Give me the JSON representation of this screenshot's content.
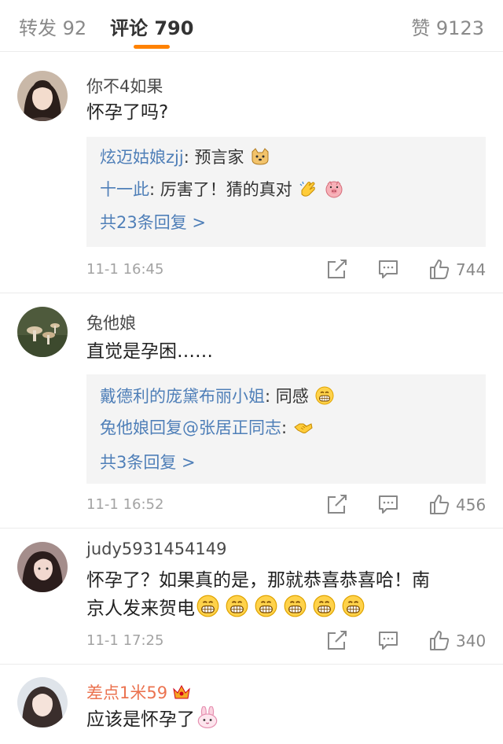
{
  "tabs": {
    "repost": "转发 92",
    "comment": "评论 790",
    "like": "赞 9123"
  },
  "colors": {
    "accent": "#ff8200",
    "link": "#4f7fb8",
    "vip_name": "#eb7350"
  },
  "comments": [
    {
      "user": "你不4如果",
      "text": "怀孕了吗?",
      "replies": [
        {
          "name": "炫迈姑娘zjj",
          "text": ": 预言家",
          "emojis": [
            "doge-emoji"
          ]
        },
        {
          "name": "十一此",
          "text": ": 厉害了！猜的真对",
          "emojis": [
            "clapping-hands-emoji",
            "pig-emoji"
          ]
        }
      ],
      "more": "共23条回复 >",
      "time": "11-1 16:45",
      "likes": "744"
    },
    {
      "user": "兔他娘",
      "text": "直觉是孕困……",
      "replies": [
        {
          "name": "戴德利的庞黛布丽小姐",
          "text": ": 同感",
          "emojis": [
            "grin-emoji"
          ]
        },
        {
          "name": "兔他娘回复@张居正同志",
          "text": ":",
          "emojis": [
            "handshake-emoji"
          ]
        }
      ],
      "more": "共3条回复 >",
      "time": "11-1 16:52",
      "likes": "456"
    },
    {
      "user": "judy5931454149",
      "text_line1": "怀孕了？如果真的是，那就恭喜恭喜哈！南",
      "text_line2": "京人发来贺电",
      "emojis": [
        "grin-emoji",
        "grin-emoji",
        "grin-emoji",
        "grin-emoji",
        "grin-emoji",
        "grin-emoji"
      ],
      "time": "11-1 17:25",
      "likes": "340"
    },
    {
      "user": "差点1米59",
      "badge": "crown-icon",
      "text": "应该是怀孕了",
      "emojis": [
        "bunny-emoji"
      ]
    }
  ]
}
